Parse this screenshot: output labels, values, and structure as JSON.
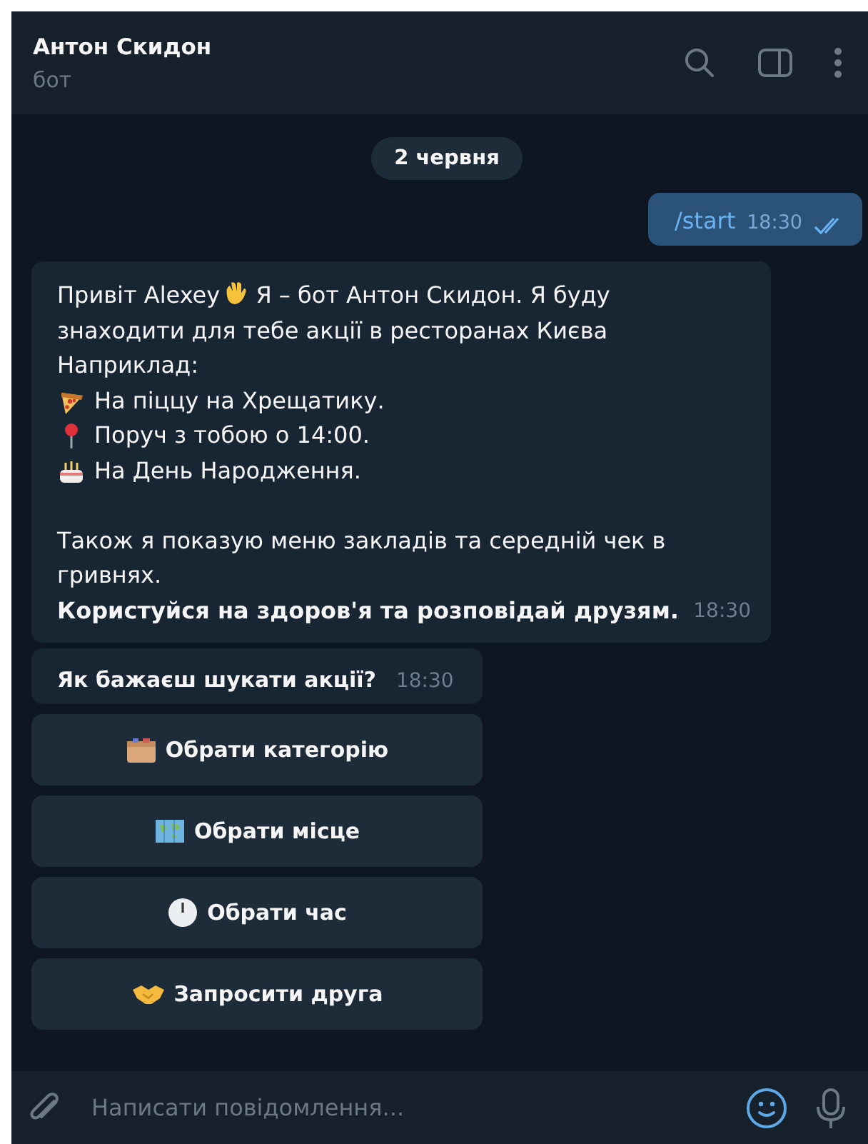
{
  "header": {
    "title": "Антон Скидон",
    "subtitle": "бот"
  },
  "date": "2 червня",
  "messages": [
    {
      "kind": "outgoing",
      "text": "/start",
      "time": "18:30",
      "read": true
    },
    {
      "kind": "welcome",
      "greeting": "Привіт Alexey",
      "intro": "Я – бот Антон Скидон. Я буду знаходити для тебе акції в ресторанах Києва",
      "lead": "Наприклад:",
      "items": [
        {
          "text": "На піццу на Хрещатику."
        },
        {
          "text": "Поруч з тобою о 14:00."
        },
        {
          "text": "На День Народження."
        }
      ],
      "note": "Також я показую меню закладів та середній чек в гривнях.",
      "closing": "Користуйся на здоров'я та розповідай друзям.",
      "time": "18:30"
    },
    {
      "kind": "incoming",
      "text": "Як бажаєш шукати акції?",
      "time": "18:30"
    }
  ],
  "keyboard": [
    {
      "label": "Обрати категорію"
    },
    {
      "label": "Обрати місце"
    },
    {
      "label": "Обрати час"
    },
    {
      "label": "Запросити друга"
    }
  ],
  "composer": {
    "placeholder": "Написати повідомлення..."
  }
}
